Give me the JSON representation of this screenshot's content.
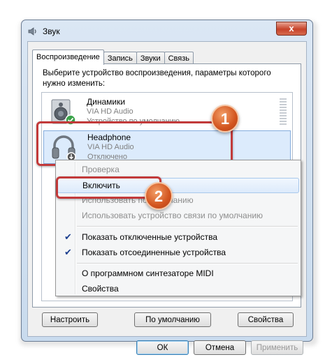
{
  "window": {
    "title": "Звук",
    "close": "x"
  },
  "tabs": [
    "Воспроизведение",
    "Запись",
    "Звуки",
    "Связь"
  ],
  "instruction": "Выберите устройство воспроизведения, параметры которого нужно изменить:",
  "devices": [
    {
      "name": "Динамики",
      "driver": "VIA HD Audio",
      "status": "Устройство по умолчанию"
    },
    {
      "name": "Headphone",
      "driver": "VIA HD Audio",
      "status": "Отключено"
    }
  ],
  "annotations": {
    "step1": "1",
    "step2": "2"
  },
  "context_menu": [
    {
      "label": "Проверка",
      "enabled": false
    },
    {
      "label": "Включить",
      "enabled": true,
      "highlighted": true
    },
    {
      "label": "Использовать по умолчанию",
      "enabled": false
    },
    {
      "label": "Использовать устройство связи по умолчанию",
      "enabled": false
    },
    {
      "label": "Показать отключенные устройства",
      "checked": true
    },
    {
      "label": "Показать отсоединенные устройства",
      "checked": true
    },
    {
      "label": "О программном синтезаторе MIDI"
    },
    {
      "label": "Свойства"
    }
  ],
  "buttons": {
    "configure": "Настроить",
    "set_default": "По умолчанию",
    "properties": "Свойства",
    "ok": "ОК",
    "cancel": "Отмена",
    "apply": "Применить"
  },
  "colors": {
    "callout": "#c23a3a",
    "badge": "#d2541e",
    "selection": "#dcebfc",
    "check": "#1b3f8f"
  }
}
